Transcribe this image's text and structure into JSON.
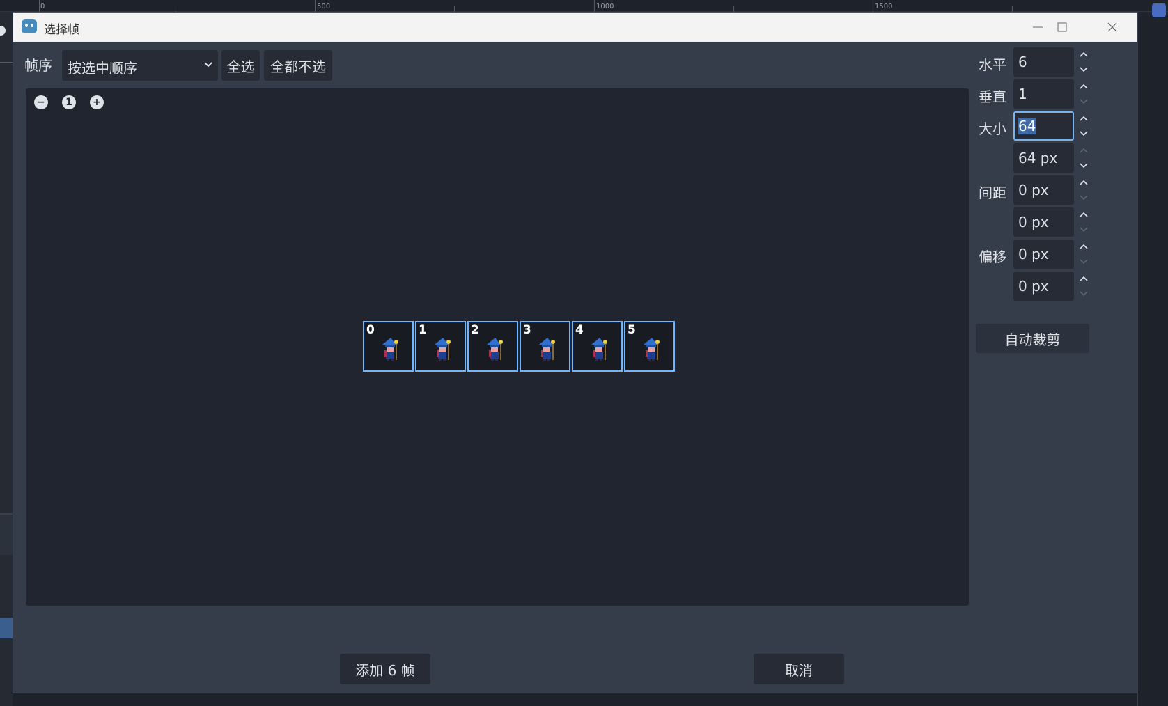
{
  "ruler": {
    "labels": [
      "0",
      "500",
      "1000",
      "1500"
    ]
  },
  "dialog": {
    "title": "选择帧",
    "controls": {
      "minimize": "—",
      "maximize": "☐",
      "close": "✕"
    }
  },
  "toolbar": {
    "frame_order_label": "帧序",
    "order_select_value": "按选中顺序",
    "select_all": "全选",
    "select_none": "全都不选",
    "toggle_panel_glyph": "❯"
  },
  "zoom": {
    "out": "−",
    "reset": "1",
    "in": "+"
  },
  "frames": [
    {
      "index": "0"
    },
    {
      "index": "1"
    },
    {
      "index": "2"
    },
    {
      "index": "3"
    },
    {
      "index": "4"
    },
    {
      "index": "5"
    }
  ],
  "panel": {
    "horizontal_label": "水平",
    "horizontal_value": "6",
    "vertical_label": "垂直",
    "vertical_value": "1",
    "size_label": "大小",
    "size_x": "64",
    "size_y": "64 px",
    "separation_label": "间距",
    "separation_x": "0 px",
    "separation_y": "0 px",
    "offset_label": "偏移",
    "offset_x": "0 px",
    "offset_y": "0 px",
    "auto_slice": "自动裁剪"
  },
  "footer": {
    "add_frames": "添加 6 帧",
    "cancel": "取消"
  },
  "colors": {
    "selection_border": "#6fb5ff",
    "focus_border": "#76b3f0"
  }
}
